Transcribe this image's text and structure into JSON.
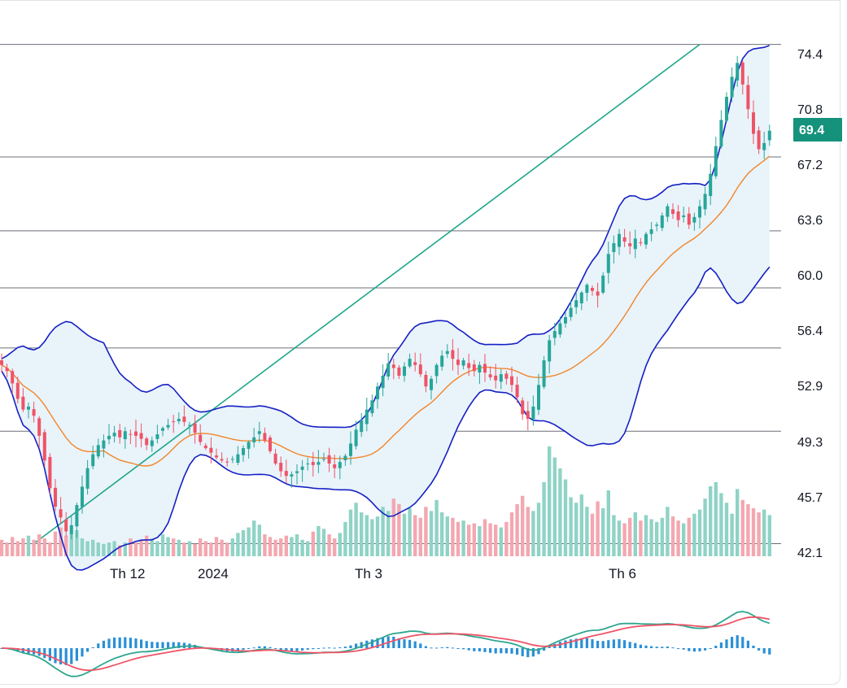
{
  "colors": {
    "up": "#26a69a",
    "down": "#ef5366",
    "up_volume": "#8fd3c6",
    "down_volume": "#f4a7b0",
    "bollinger": "#1520c4",
    "bollinger_fill": "#e9f3fa",
    "ma": "#f0862a",
    "trendline": "#1fa58a",
    "hline": "#6b6f78",
    "macd": "#2ea68f",
    "signal": "#ef5366",
    "histogram": "#2a8fd6",
    "price_tag": "#15927c"
  },
  "chart_data": {
    "type": "candlestick",
    "y_axis_ticks": [
      "74.4",
      "70.8",
      "67.2",
      "63.6",
      "60.0",
      "56.4",
      "52.9",
      "49.3",
      "45.7",
      "42.1"
    ],
    "ylim": [
      42.1,
      74.4
    ],
    "x_axis_labels": [
      "Th 12",
      "2024",
      "Th 3",
      "Th 6"
    ],
    "current_price": "69.4",
    "horizontal_levels": [
      75.0,
      67.7,
      62.9,
      59.2,
      55.3,
      49.9,
      42.6
    ],
    "trendline": {
      "from": {
        "index": 6,
        "price": 42.6
      },
      "to": {
        "index": 130,
        "price": 75.0
      }
    },
    "closes": [
      54.2,
      53.8,
      53.0,
      52.0,
      51.3,
      51.5,
      50.9,
      49.6,
      48.0,
      46.2,
      45.0,
      44.3,
      43.4,
      43.8,
      45.1,
      46.3,
      47.5,
      48.4,
      49.0,
      49.3,
      49.6,
      49.8,
      49.5,
      49.9,
      49.7,
      49.6,
      49.4,
      49.0,
      49.3,
      49.7,
      50.1,
      50.3,
      50.5,
      50.7,
      50.5,
      50.3,
      49.8,
      49.2,
      48.8,
      48.5,
      48.2,
      48.0,
      47.9,
      48.1,
      48.4,
      48.8,
      49.2,
      49.5,
      49.9,
      49.3,
      48.6,
      47.8,
      47.3,
      47.0,
      47.1,
      47.3,
      47.6,
      47.8,
      47.7,
      47.9,
      48.1,
      47.8,
      47.5,
      47.9,
      48.3,
      49.1,
      50.0,
      50.6,
      51.3,
      51.9,
      52.8,
      53.5,
      54.3,
      54.0,
      53.5,
      54.1,
      54.6,
      54.2,
      53.6,
      52.8,
      53.3,
      54.2,
      54.8,
      55.1,
      54.6,
      54.2,
      54.5,
      54.0,
      53.8,
      54.2,
      53.7,
      53.4,
      53.2,
      53.6,
      53.3,
      52.9,
      52.1,
      51.0,
      50.7,
      51.5,
      52.9,
      54.5,
      55.8,
      56.4,
      56.9,
      57.3,
      57.9,
      58.4,
      58.9,
      59.4,
      59.0,
      58.7,
      60.0,
      61.4,
      62.1,
      62.7,
      62.2,
      61.9,
      62.4,
      62.1,
      62.7,
      63.0,
      63.3,
      63.9,
      64.5,
      64.0,
      63.6,
      63.9,
      63.3,
      63.8,
      64.5,
      65.3,
      66.6,
      68.4,
      70.1,
      71.6,
      72.9,
      73.8,
      72.4,
      70.8,
      69.2,
      68.2,
      68.6,
      69.4
    ],
    "volumes": [
      1.2,
      1.0,
      1.4,
      1.1,
      1.3,
      1.5,
      1.2,
      1.6,
      1.3,
      1.0,
      1.8,
      2.1,
      1.5,
      1.7,
      1.9,
      1.3,
      1.1,
      1.2,
      1.0,
      0.9,
      1.0,
      1.1,
      0.8,
      1.0,
      1.3,
      1.0,
      1.2,
      1.5,
      1.3,
      1.1,
      1.6,
      1.4,
      1.3,
      1.2,
      1.0,
      1.1,
      0.9,
      1.3,
      1.1,
      1.0,
      1.4,
      1.2,
      1.0,
      1.3,
      1.7,
      1.9,
      2.1,
      2.6,
      2.3,
      1.6,
      1.4,
      1.2,
      1.3,
      1.5,
      1.4,
      1.6,
      1.2,
      1.1,
      1.8,
      2.2,
      2.0,
      1.6,
      1.3,
      1.7,
      2.5,
      3.4,
      3.9,
      3.2,
      3.0,
      2.7,
      2.9,
      3.6,
      3.3,
      4.2,
      3.8,
      3.1,
      3.5,
      3.0,
      2.8,
      3.6,
      3.3,
      4.1,
      3.2,
      2.9,
      2.8,
      2.5,
      2.6,
      2.3,
      2.4,
      2.2,
      2.7,
      2.4,
      2.3,
      2.1,
      2.5,
      3.2,
      3.8,
      4.4,
      3.6,
      3.3,
      3.9,
      5.4,
      8.0,
      7.2,
      6.4,
      5.6,
      4.3,
      3.9,
      4.5,
      3.6,
      3.1,
      4.0,
      3.5,
      4.8,
      3.0,
      2.6,
      2.4,
      2.8,
      3.2,
      2.6,
      3.0,
      2.7,
      2.5,
      2.8,
      3.6,
      2.9,
      2.6,
      2.4,
      2.8,
      3.1,
      3.4,
      4.2,
      5.1,
      5.4,
      4.6,
      3.9,
      3.1,
      4.9,
      4.1,
      3.8,
      3.5,
      3.2,
      3.4,
      3.0
    ]
  }
}
